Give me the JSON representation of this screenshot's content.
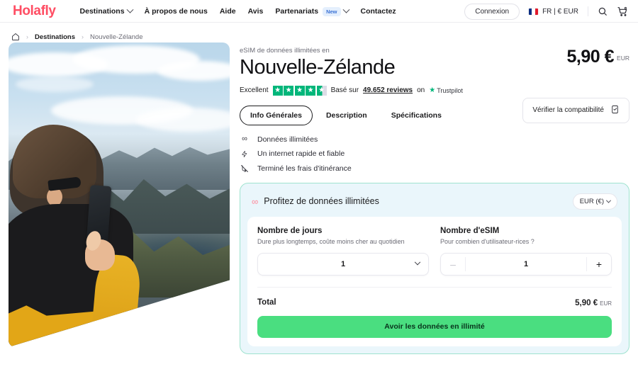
{
  "header": {
    "logo": "Holafly",
    "nav": [
      {
        "label": "Destinations",
        "icon": "chevron-down-icon",
        "has_caret": true
      },
      {
        "label": "À propos de nous",
        "has_caret": false
      },
      {
        "label": "Aide",
        "has_caret": false
      },
      {
        "label": "Avis",
        "has_caret": false
      },
      {
        "label": "Partenariats",
        "badge": "New",
        "has_caret": true
      },
      {
        "label": "Contactez",
        "has_caret": false
      }
    ],
    "login_label": "Connexion",
    "locale_label": "FR | € EUR",
    "search_icon": "search-icon",
    "cart_icon": "cart-icon"
  },
  "breadcrumb": {
    "home_icon": "home-icon",
    "sep": "›",
    "items": [
      {
        "label": "Destinations"
      },
      {
        "label": "Nouvelle-Zélande"
      }
    ]
  },
  "hero": {
    "alt": "man-photographing-mountains"
  },
  "product": {
    "eyebrow": "eSIM de données illimitées en",
    "title": "Nouvelle-Zélande",
    "price": "5,90 €",
    "price_currency": "EUR"
  },
  "trustpilot": {
    "rating_word": "Excellent",
    "stars_full": 4,
    "stars_half": true,
    "based_on": "Basé sur",
    "reviews": "49.652 reviews",
    "on": "on",
    "brand": "Trustpilot",
    "star_color": "#00b67a"
  },
  "tabs": [
    {
      "label": "Info Générales",
      "active": true
    },
    {
      "label": "Description",
      "active": false
    },
    {
      "label": "Spécifications",
      "active": false
    }
  ],
  "compat_button": {
    "label": "Vérifier la compatibilité",
    "icon": "phone-check-icon"
  },
  "features": [
    {
      "icon": "infinity-icon",
      "glyph": "∞",
      "label": "Données illimitées"
    },
    {
      "icon": "bolt-icon",
      "glyph": "⚡",
      "label": "Un internet rapide et fiable"
    },
    {
      "icon": "no-roaming-icon",
      "glyph": "↘",
      "label": "Terminé les frais d'itinérance"
    }
  ],
  "purchase": {
    "title": "Profitez de données illimitées",
    "title_icon": "infinity-icon",
    "title_glyph": "∞",
    "currency_select": "EUR (€)",
    "days": {
      "label": "Nombre de jours",
      "hint": "Dure plus longtemps, coûte moins cher au quotidien",
      "value": "1"
    },
    "esims": {
      "label": "Nombre d'eSIM",
      "hint": "Pour combien d'utilisateur-rices ?",
      "value": "1",
      "minus": "–",
      "plus": "+"
    },
    "total_label": "Total",
    "total_value": "5,90 €",
    "total_currency": "EUR",
    "cta_label": "Avoir les données en illimité",
    "cta_color": "#4ade80",
    "card_bg": "#eaf6fb",
    "card_border": "#9fe3cf"
  }
}
